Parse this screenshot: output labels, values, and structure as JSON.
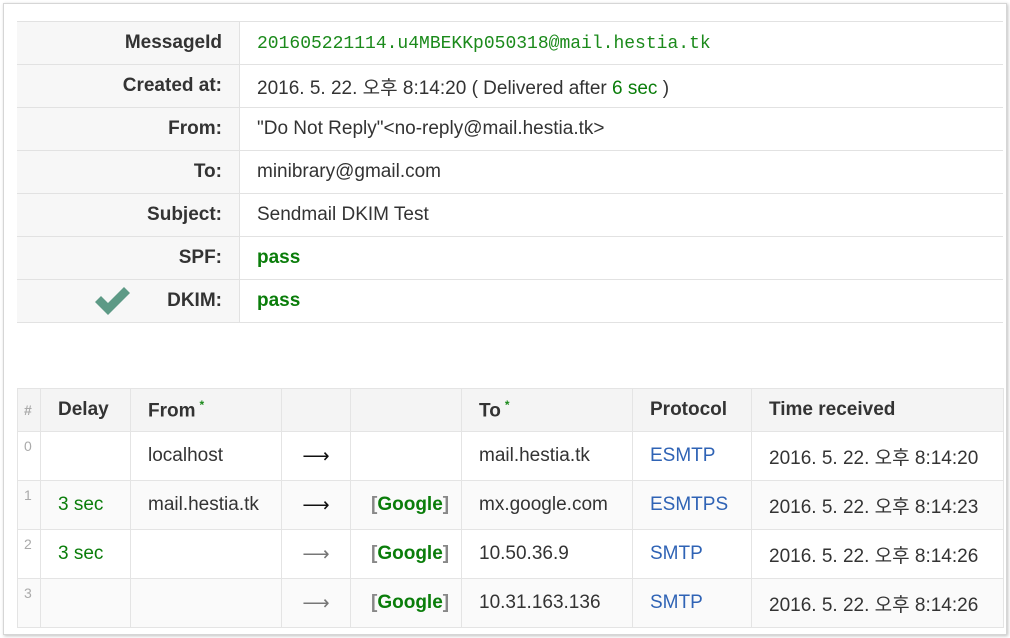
{
  "header": {
    "message_id_label": "MessageId",
    "message_id": "201605221114.u4MBEKKp050318@mail.hestia.tk",
    "created_label": "Created at:",
    "created_date": "2016. 5. 22. 오후 8:14:20",
    "delivered_prefix": "( Delivered after",
    "delivered_delay": "6 sec",
    "delivered_suffix": ")",
    "from_label": "From:",
    "from_value": "\"Do Not Reply\"<no-reply@mail.hestia.tk>",
    "to_label": "To:",
    "to_value": "minibrary@gmail.com",
    "subject_label": "Subject:",
    "subject_value": "Sendmail DKIM Test",
    "spf_label": "SPF:",
    "spf_value": "pass",
    "dkim_label": "DKIM:",
    "dkim_value": "pass",
    "dkim_icon": "checkmark-icon",
    "check_color": "#5d9a86"
  },
  "hops": {
    "columns": {
      "num": "#",
      "delay": "Delay",
      "from": "From",
      "from_mark": "*",
      "to": "To",
      "to_mark": "*",
      "protocol": "Protocol",
      "time": "Time received"
    },
    "rows": [
      {
        "num": "0",
        "delay": "",
        "from": "localhost",
        "arrow": "⟶",
        "via": "",
        "to": "mail.hestia.tk",
        "protocol": "ESMTP",
        "time": "2016. 5. 22. 오후 8:14:20"
      },
      {
        "num": "1",
        "delay": "3 sec",
        "from": "mail.hestia.tk",
        "arrow": "⟶",
        "via": "Google",
        "to": "mx.google.com",
        "protocol": "ESMTPS",
        "time": "2016. 5. 22. 오후 8:14:23"
      },
      {
        "num": "2",
        "delay": "3 sec",
        "from": "",
        "arrow": "⟶",
        "via": "Google",
        "to": "10.50.36.9",
        "protocol": "SMTP",
        "time": "2016. 5. 22. 오후 8:14:26"
      },
      {
        "num": "3",
        "delay": "",
        "from": "",
        "arrow": "⟶",
        "via": "Google",
        "to": "10.31.163.136",
        "protocol": "SMTP",
        "time": "2016. 5. 22. 오후 8:14:26"
      }
    ]
  }
}
